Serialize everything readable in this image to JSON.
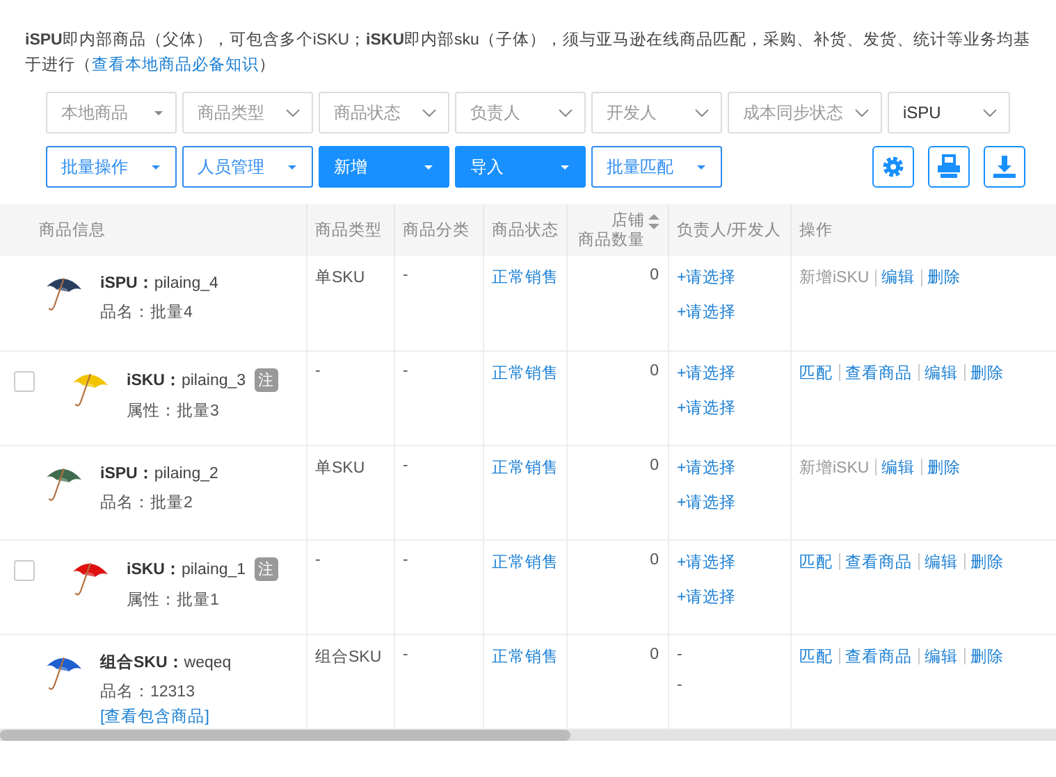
{
  "notice": {
    "text": "**iSPU**即内部商品（父体），可包含多个iSKU；**iSKU**即内部sku（子体），须与亚马逊在线商品匹配，采购、补货、发货、统计等业务均基于进行（",
    "link": "查看本地商品必备知识",
    "after": "）"
  },
  "filters": [
    {
      "kind": "menu",
      "placeholder": "本地商品"
    },
    {
      "kind": "select",
      "placeholder": "商品类型"
    },
    {
      "kind": "select",
      "placeholder": "商品状态"
    },
    {
      "kind": "select",
      "placeholder": "负责人"
    },
    {
      "kind": "select",
      "placeholder": "开发人"
    },
    {
      "kind": "select",
      "placeholder": "成本同步状态"
    },
    {
      "kind": "select",
      "value": "iSPU"
    }
  ],
  "actions": [
    {
      "label": "批量操作",
      "primary": false
    },
    {
      "label": "人员管理",
      "primary": false
    },
    {
      "label": "新增",
      "primary": true
    },
    {
      "label": "导入",
      "primary": true
    },
    {
      "label": "批量匹配",
      "primary": false
    }
  ],
  "tools": [
    {
      "kind": "settings"
    },
    {
      "kind": "print"
    },
    {
      "kind": "download"
    }
  ],
  "table": {
    "columns": [
      {
        "label": "商品信息"
      },
      {
        "label": "商品类型"
      },
      {
        "label": "商品分类"
      },
      {
        "label": "商品状态"
      },
      {
        "lines": [
          "店铺",
          "商品数量"
        ],
        "sortable": true
      },
      {
        "label": "负责人/开发人"
      },
      {
        "label": "操作"
      }
    ],
    "rows": [
      {
        "kind": "spu",
        "title": "**iSPU：**pilaing_4",
        "subtitle": "品名：批量4",
        "type": "单SKU",
        "category": "-",
        "status": "正常销售",
        "count": "0",
        "people": [
          {
            "kind": "link",
            "text": "+请选择"
          },
          {
            "kind": "link",
            "text": "+请选择"
          }
        ],
        "ops": [
          {
            "text": "新增iSKU",
            "disabled": true
          },
          {
            "text": "编辑",
            "disabled": false
          },
          {
            "text": "删除",
            "disabled": false
          }
        ]
      },
      {
        "kind": "sku",
        "checked": false,
        "badge": "注",
        "title": "**iSKU：**pilaing_3",
        "subtitle": "属性：批量3",
        "type": "-",
        "category": "-",
        "status": "正常销售",
        "count": "0",
        "people": [
          {
            "kind": "link",
            "text": "+请选择"
          },
          {
            "kind": "link",
            "text": "+请选择"
          }
        ],
        "ops": [
          {
            "text": "匹配",
            "disabled": false
          },
          {
            "text": "查看商品",
            "disabled": false
          },
          {
            "text": "编辑",
            "disabled": false
          },
          {
            "text": "删除",
            "disabled": false
          }
        ]
      },
      {
        "kind": "spu",
        "title": "**iSPU：**pilaing_2",
        "subtitle": "品名：批量2",
        "type": "单SKU",
        "category": "-",
        "status": "正常销售",
        "count": "0",
        "people": [
          {
            "kind": "link",
            "text": "+请选择"
          },
          {
            "kind": "link",
            "text": "+请选择"
          }
        ],
        "ops": [
          {
            "text": "新增iSKU",
            "disabled": true
          },
          {
            "text": "编辑",
            "disabled": false
          },
          {
            "text": "删除",
            "disabled": false
          }
        ]
      },
      {
        "kind": "sku",
        "checked": false,
        "badge": "注",
        "title": "**iSKU：**pilaing_1",
        "subtitle": "属性：批量1",
        "type": "-",
        "category": "-",
        "status": "正常销售",
        "count": "0",
        "people": [
          {
            "kind": "link",
            "text": "+请选择"
          },
          {
            "kind": "link",
            "text": "+请选择"
          }
        ],
        "ops": [
          {
            "text": "匹配",
            "disabled": false
          },
          {
            "text": "查看商品",
            "disabled": false
          },
          {
            "text": "编辑",
            "disabled": false
          },
          {
            "text": "删除",
            "disabled": false
          }
        ]
      },
      {
        "kind": "combo",
        "title": "**组合SKU：**weqeq",
        "subtitle": "品名：12313",
        "link": "[查看包含商品]",
        "type": "组合SKU",
        "category": "-",
        "status": "正常销售",
        "count": "0",
        "people": [
          {
            "kind": "text",
            "text": "-"
          },
          {
            "kind": "text",
            "text": "-"
          }
        ],
        "ops": [
          {
            "text": "匹配",
            "disabled": false
          },
          {
            "text": "查看商品",
            "disabled": false
          },
          {
            "text": "编辑",
            "disabled": false
          },
          {
            "text": "删除",
            "disabled": false
          }
        ]
      }
    ]
  }
}
